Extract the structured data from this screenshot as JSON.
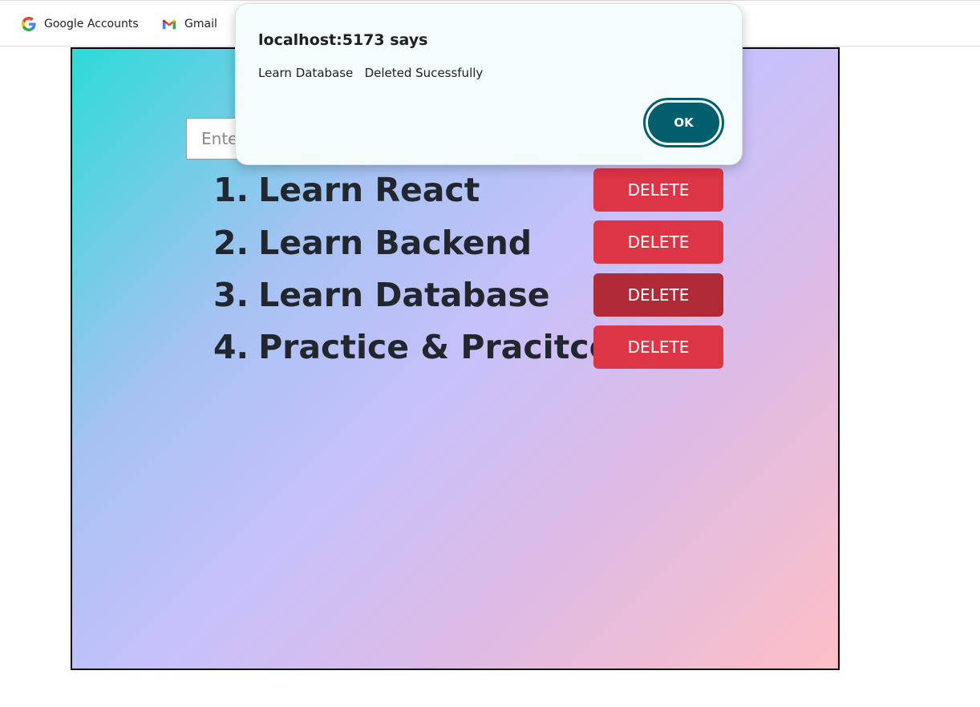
{
  "bookmarks": [
    {
      "label": "Google Accounts",
      "icon": "google-g-icon"
    },
    {
      "label": "Gmail",
      "icon": "gmail-icon"
    }
  ],
  "app": {
    "input_placeholder": "Enter",
    "delete_label": "DELETE",
    "tasks": [
      {
        "index": "1.",
        "text": "Learn React"
      },
      {
        "index": "2.",
        "text": "Learn Backend"
      },
      {
        "index": "3.",
        "text": "Learn Database"
      },
      {
        "index": "4.",
        "text": "Practice & Pracitce"
      }
    ]
  },
  "dialog": {
    "title": "localhost:5173 says",
    "message": "Learn Database   Deleted Sucessfully",
    "ok_label": "OK"
  },
  "colors": {
    "delete": "#dc3545",
    "delete_active": "#b02a37",
    "ok": "#005f6b",
    "gradient_start": "#2ddbd6",
    "gradient_end": "#fdbfc6"
  }
}
